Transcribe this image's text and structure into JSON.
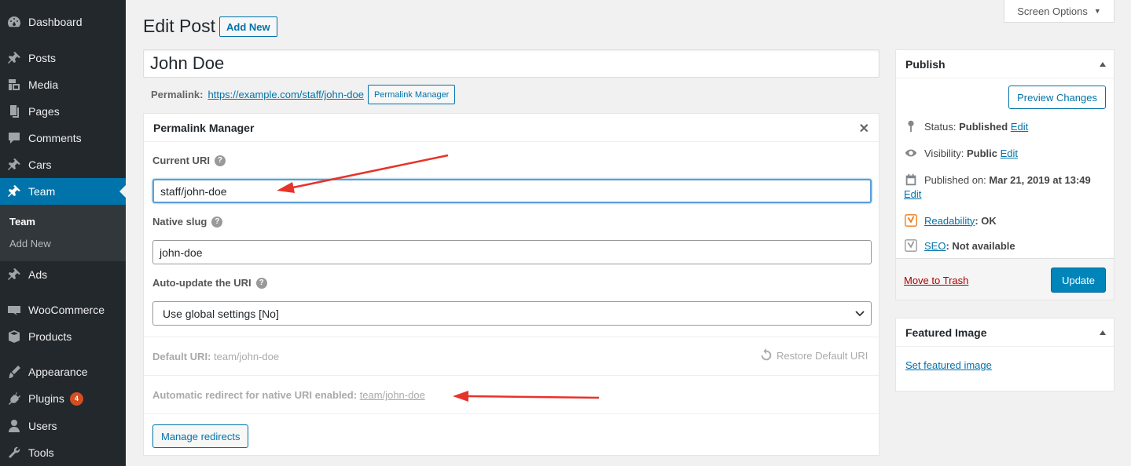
{
  "sidebar": {
    "items": [
      {
        "label": "Dashboard",
        "icon": "dashboard-icon"
      },
      {
        "label": "Posts",
        "icon": "pin-icon"
      },
      {
        "label": "Media",
        "icon": "media-icon"
      },
      {
        "label": "Pages",
        "icon": "pages-icon"
      },
      {
        "label": "Comments",
        "icon": "comments-icon"
      },
      {
        "label": "Cars",
        "icon": "pin-icon"
      },
      {
        "label": "Team",
        "icon": "pin-icon"
      },
      {
        "label": "Ads",
        "icon": "pin-icon"
      },
      {
        "label": "WooCommerce",
        "icon": "woo-icon"
      },
      {
        "label": "Products",
        "icon": "box-icon"
      },
      {
        "label": "Appearance",
        "icon": "brush-icon"
      },
      {
        "label": "Plugins",
        "icon": "plugin-icon"
      },
      {
        "label": "Users",
        "icon": "user-icon"
      },
      {
        "label": "Tools",
        "icon": "wrench-icon"
      }
    ],
    "submenu": {
      "current": "Team",
      "add_new": "Add New"
    },
    "plugins_badge": "4"
  },
  "header": {
    "screen_options": "Screen Options",
    "title": "Edit Post",
    "add_new": "Add New"
  },
  "post": {
    "title": "John Doe",
    "permalink_label": "Permalink:",
    "permalink_url": "https://example.com/staff/john-doe",
    "permalink_manager_btn": "Permalink Manager"
  },
  "permalink_manager": {
    "title": "Permalink Manager",
    "close": "✕",
    "current_uri_label": "Current URI",
    "current_uri_value": "staff/john-doe",
    "native_slug_label": "Native slug",
    "native_slug_value": "john-doe",
    "auto_update_label": "Auto-update the URI",
    "auto_update_value": "Use global settings [No]",
    "default_uri_label": "Default URI:",
    "default_uri_value": "team/john-doe",
    "restore_default": "Restore Default URI",
    "redirect_label": "Automatic redirect for native URI enabled:",
    "redirect_value": "team/john-doe",
    "manage_redirects": "Manage redirects"
  },
  "publish": {
    "title": "Publish",
    "preview": "Preview Changes",
    "status_label": "Status:",
    "status_value": "Published",
    "visibility_label": "Visibility:",
    "visibility_value": "Public",
    "published_label": "Published on:",
    "published_value": "Mar 21, 2019 at 13:49",
    "edit": "Edit",
    "readability": "Readability",
    "readability_value": ": OK",
    "seo": "SEO",
    "seo_value": ": Not available",
    "trash": "Move to Trash",
    "update": "Update"
  },
  "featured_image": {
    "title": "Featured Image",
    "link": "Set featured image"
  },
  "colors": {
    "accent": "#0073aa",
    "sidebar": "#23282d",
    "annotation_arrow": "#e8332a"
  }
}
